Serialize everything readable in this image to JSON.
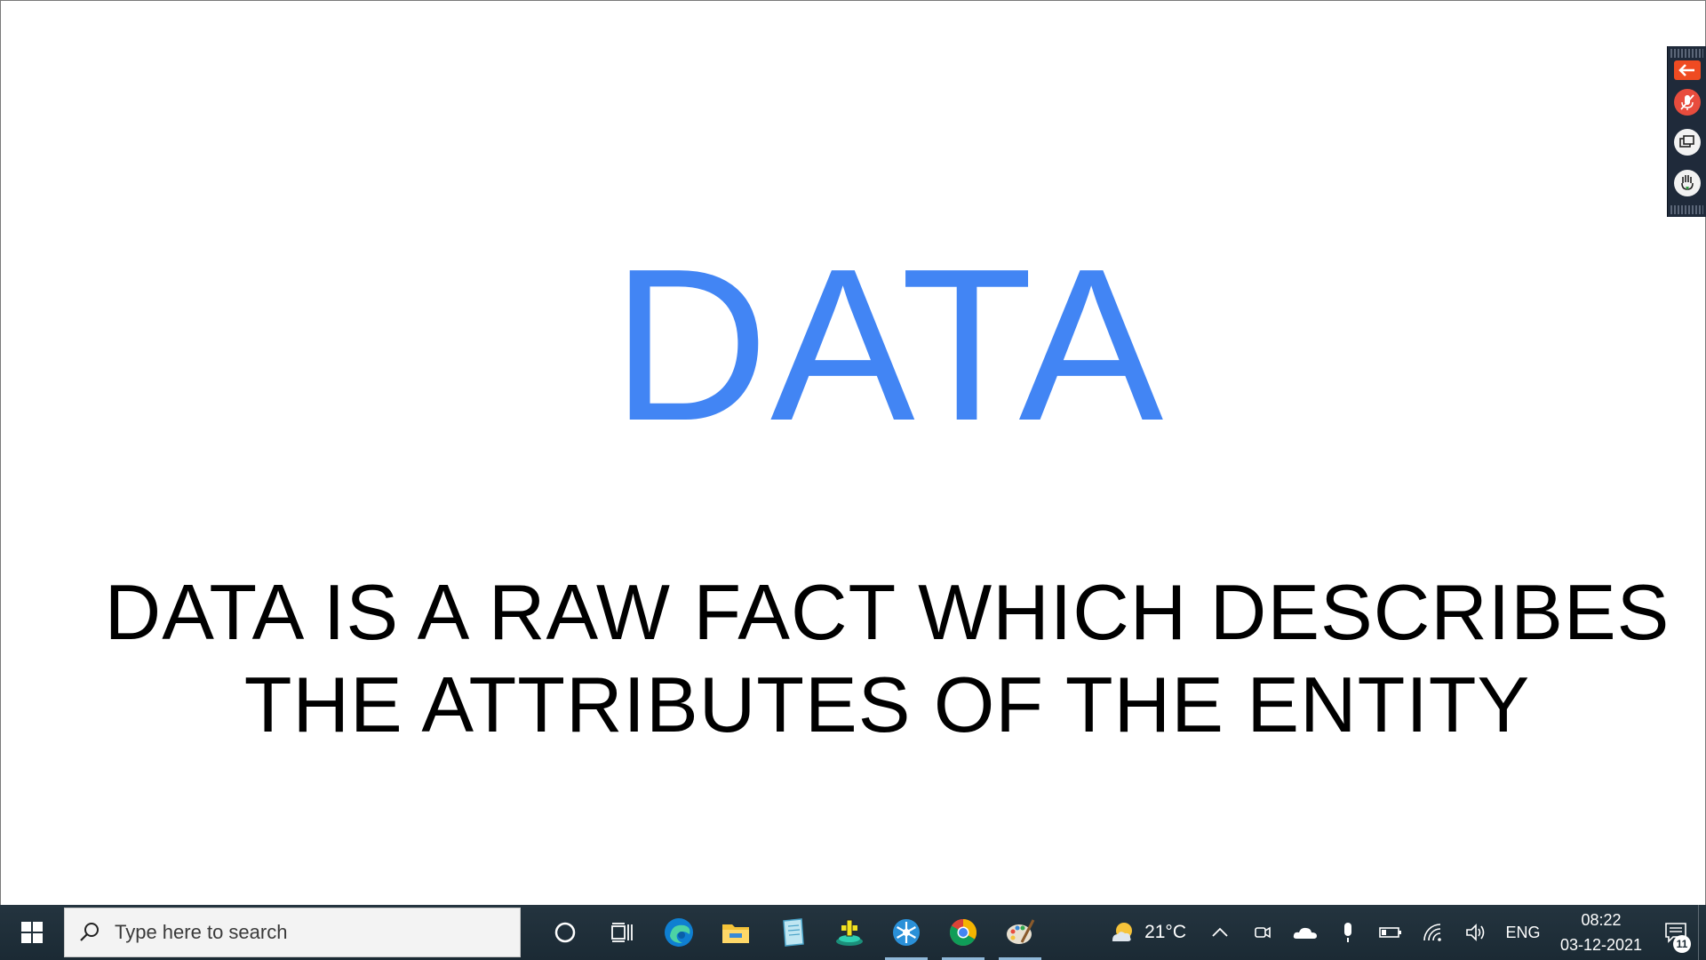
{
  "slide": {
    "title": "DATA",
    "body_line1": "DATA IS A RAW FACT WHICH DESCRIBES",
    "body_line2": "THE ATTRIBUTES OF THE ENTITY"
  },
  "meeting_toolbar": {
    "buttons": [
      "back-arrow-icon",
      "mic-muted-icon",
      "screen-share-icon",
      "raise-hand-icon"
    ]
  },
  "taskbar": {
    "search_placeholder": "Type here to search",
    "pinned_apps": [
      "cortana-icon",
      "task-view-icon",
      "edge-icon",
      "file-explorer-icon",
      "notepad-icon",
      "app-plus-icon",
      "snowflake-app-icon",
      "chrome-icon",
      "paint-icon"
    ],
    "weather": {
      "temperature": "21°C",
      "icon": "partly-sunny-icon"
    },
    "tray_icons": [
      "chevron-up-icon",
      "meet-now-icon",
      "onedrive-icon",
      "microphone-icon",
      "battery-icon",
      "wifi-icon",
      "volume-icon"
    ],
    "language": "ENG",
    "time": "08:22",
    "date": "03-12-2021",
    "notification_count": "11"
  },
  "colors": {
    "title": "#4285f4",
    "taskbar": "#1b2a34",
    "toolbar": "#1f2a3a"
  }
}
